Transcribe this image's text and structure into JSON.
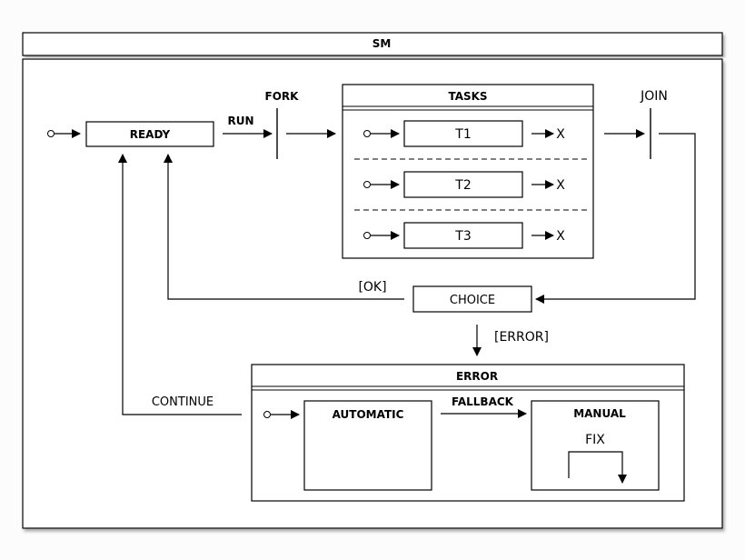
{
  "machine": {
    "title": "SM"
  },
  "states": {
    "ready": "READY",
    "tasks": "TASKS",
    "t1": "T1",
    "t2": "T2",
    "t3": "T3",
    "choice": "CHOICE",
    "error": "ERROR",
    "automatic": "AUTOMATIC",
    "manual": "MANUAL"
  },
  "pseudo": {
    "fork": "FORK",
    "join": "JOIN",
    "final_marker": "X"
  },
  "transitions": {
    "run": "RUN",
    "ok": "[OK]",
    "error": "[ERROR]",
    "continue": "CONTINUE",
    "fallback": "FALLBACK",
    "fix": "FIX"
  }
}
